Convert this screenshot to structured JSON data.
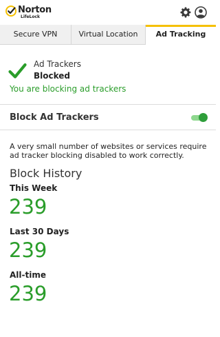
{
  "brand": {
    "name": "Norton",
    "sub": "LifeLock",
    "accent": "#f5c000"
  },
  "tabs": [
    {
      "label": "Secure VPN",
      "active": false
    },
    {
      "label": "Virtual Location",
      "active": false
    },
    {
      "label": "Ad Tracking",
      "active": true
    }
  ],
  "status": {
    "title": "Ad Trackers",
    "state": "Blocked",
    "message": "You are blocking ad trackers",
    "icon": "checkmark-icon",
    "color": "#2a9d2a"
  },
  "setting": {
    "label": "Block Ad Trackers",
    "enabled": true
  },
  "note": "A very small number of websites or services require ad tracker blocking disabled to work correctly.",
  "history": {
    "title": "Block History",
    "periods": [
      {
        "label": "This Week",
        "value": "239"
      },
      {
        "label": "Last 30 Days",
        "value": "239"
      },
      {
        "label": "All-time",
        "value": "239"
      }
    ]
  }
}
